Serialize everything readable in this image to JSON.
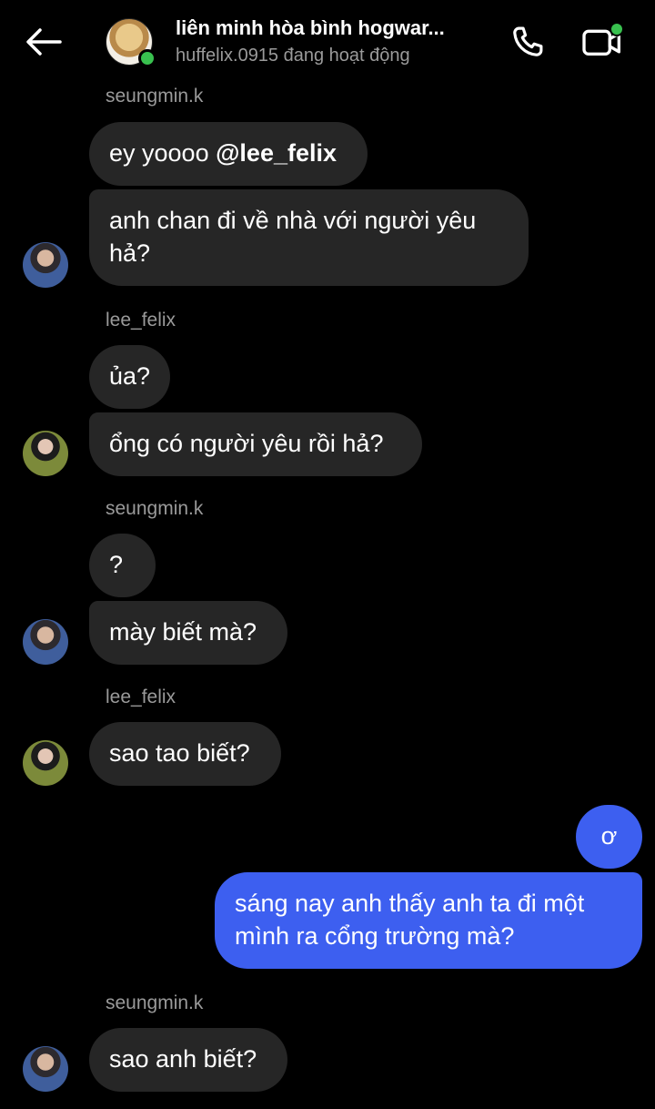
{
  "header": {
    "title": "liên minh hòa bình hogwar...",
    "status": "huffelix.0915 đang hoạt động"
  },
  "colors": {
    "background": "#000000",
    "bubble_other": "#262626",
    "bubble_mine": "#3d5ff0",
    "online": "#39c14f",
    "sender_name": "#9a9a9a"
  },
  "messages": [
    {
      "sender": "seungmin.k"
    },
    {
      "text_prefix": "ey yoooo ",
      "mention": "@lee_felix"
    },
    {
      "text": "anh chan đi về nhà với người yêu hả?"
    },
    {
      "sender": "lee_felix"
    },
    {
      "text": "ủa?"
    },
    {
      "text": "ổng có người yêu rồi hả?"
    },
    {
      "sender": "seungmin.k"
    },
    {
      "text": "?"
    },
    {
      "text": "mày biết mà?"
    },
    {
      "sender": "lee_felix"
    },
    {
      "text": "sao tao biết?"
    },
    {
      "text": "ơ"
    },
    {
      "text": "sáng nay anh thấy anh ta đi một mình ra cổng trường mà?"
    },
    {
      "sender": "seungmin.k"
    },
    {
      "text": "sao anh biết?"
    }
  ]
}
